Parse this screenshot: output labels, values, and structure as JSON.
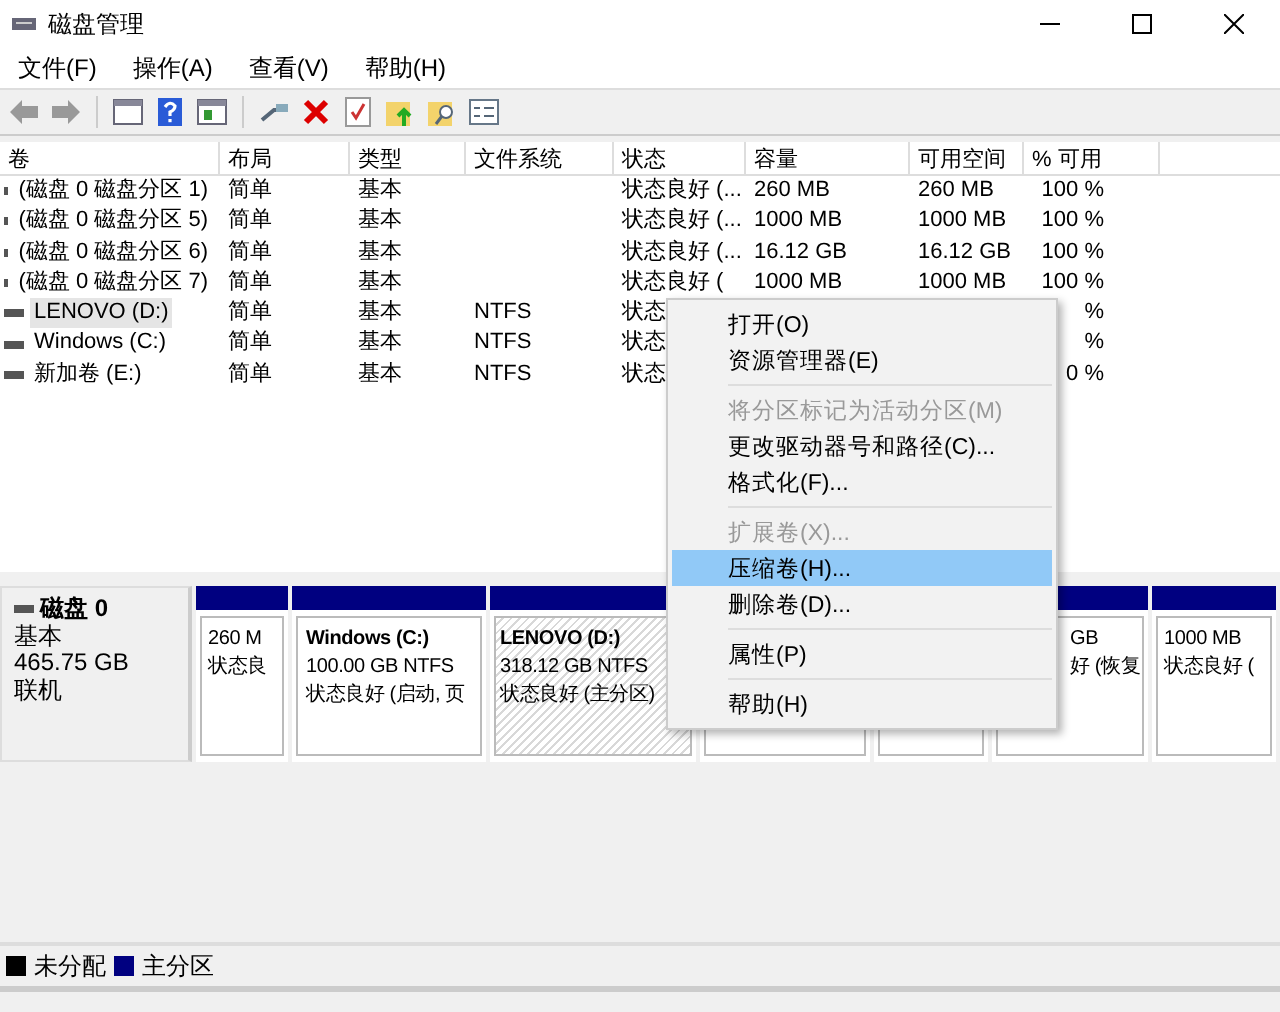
{
  "window": {
    "title": "磁盘管理"
  },
  "menu_bar": [
    "文件(F)",
    "操作(A)",
    "查看(V)",
    "帮助(H)"
  ],
  "toolbar": [
    {
      "kind": "back",
      "disabled": true
    },
    {
      "kind": "forward",
      "disabled": true
    },
    {
      "kind": "separator"
    },
    {
      "kind": "panel"
    },
    {
      "kind": "help"
    },
    {
      "kind": "panel2"
    },
    {
      "kind": "separator"
    },
    {
      "kind": "connect"
    },
    {
      "kind": "delete"
    },
    {
      "kind": "check"
    },
    {
      "kind": "folder-up"
    },
    {
      "kind": "folder-search"
    },
    {
      "kind": "list"
    }
  ],
  "table": {
    "columns": [
      "卷",
      "布局",
      "类型",
      "文件系统",
      "状态",
      "容量",
      "可用空间",
      "% 可用"
    ],
    "rows": [
      {
        "name": "(磁盘 0 磁盘分区 1)",
        "layout": "简单",
        "type": "基本",
        "status": "状态良好 (...",
        "capacity": "260 MB",
        "free": "260 MB",
        "pct": "100 %",
        "selected": false
      },
      {
        "name": "(磁盘 0 磁盘分区 5)",
        "layout": "简单",
        "type": "基本",
        "status": "状态良好 (...",
        "capacity": "1000 MB",
        "free": "1000 MB",
        "pct": "100 %",
        "selected": false
      },
      {
        "name": "(磁盘 0 磁盘分区 6)",
        "layout": "简单",
        "type": "基本",
        "status": "状态良好 (...",
        "capacity": "16.12 GB",
        "free": "16.12 GB",
        "pct": "100 %",
        "selected": false
      },
      {
        "name": "(磁盘 0 磁盘分区 7)",
        "layout": "简单",
        "type": "基本",
        "status": "状态良好 (",
        "capacity": "1000 MB",
        "free": "1000 MB",
        "pct": "100 %",
        "selected": false
      },
      {
        "name": "LENOVO (D:)",
        "layout": "简单",
        "type": "基本",
        "fs": "NTFS",
        "status": "状态",
        "pct": "%",
        "selected": true
      },
      {
        "name": "Windows (C:)",
        "layout": "简单",
        "type": "基本",
        "fs": "NTFS",
        "status": "状态",
        "pct": "%",
        "selected": false
      },
      {
        "name": "新加卷 (E:)",
        "layout": "简单",
        "type": "基本",
        "fs": "NTFS",
        "status": "状态",
        "pct": "0 %",
        "selected": false
      }
    ]
  },
  "disk": {
    "name": "磁盘 0",
    "type": "基本",
    "size": "465.75 GB",
    "state": "联机",
    "partitions": [
      {
        "lines": [
          "260 M",
          "状态良"
        ],
        "selected": false
      },
      {
        "title": "Windows  (C:)",
        "lines": [
          "100.00 GB NTFS",
          "状态良好 (启动, 页"
        ],
        "selected": false
      },
      {
        "title": "LENOVO  (D:)",
        "lines": [
          "318.12 GB NTFS",
          "状态良好 (主分区)"
        ],
        "selected": true
      },
      {
        "selected": false
      },
      {
        "selected": false
      },
      {
        "lines": [
          "GB",
          "好 (恢复"
        ],
        "selected": false
      },
      {
        "lines": [
          "1000 MB",
          "状态良好 ("
        ],
        "selected": false
      }
    ]
  },
  "context_menu": [
    {
      "kind": "item",
      "label": "打开(O)",
      "disabled": false,
      "selected": false
    },
    {
      "kind": "item",
      "label": "资源管理器(E)",
      "disabled": false,
      "selected": false
    },
    {
      "kind": "separator"
    },
    {
      "kind": "item",
      "label": "将分区标记为活动分区(M)",
      "disabled": true,
      "selected": false
    },
    {
      "kind": "item",
      "label": "更改驱动器号和路径(C)...",
      "disabled": false,
      "selected": false
    },
    {
      "kind": "item",
      "label": "格式化(F)...",
      "disabled": false,
      "selected": false
    },
    {
      "kind": "separator"
    },
    {
      "kind": "item",
      "label": "扩展卷(X)...",
      "disabled": true,
      "selected": false
    },
    {
      "kind": "item",
      "label": "压缩卷(H)...",
      "disabled": false,
      "selected": true
    },
    {
      "kind": "item",
      "label": "删除卷(D)...",
      "disabled": false,
      "selected": false
    },
    {
      "kind": "separator"
    },
    {
      "kind": "item",
      "label": "属性(P)",
      "disabled": false,
      "selected": false
    },
    {
      "kind": "separator"
    },
    {
      "kind": "item",
      "label": "帮助(H)",
      "disabled": false,
      "selected": false
    }
  ],
  "legend": [
    {
      "label": "未分配",
      "color": "#000000"
    },
    {
      "label": "主分区",
      "color": "#000080"
    }
  ]
}
